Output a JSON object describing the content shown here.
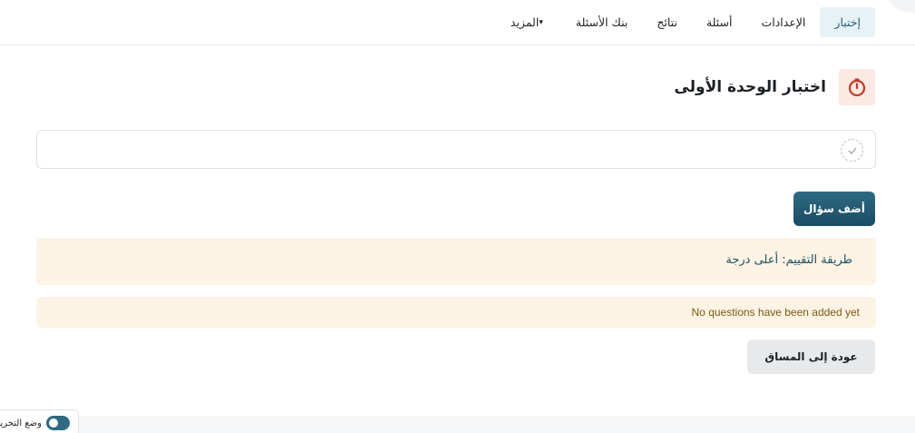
{
  "nav": {
    "tabs": [
      {
        "label": "إختبار",
        "active": true
      },
      {
        "label": "الإعدادات",
        "active": false
      },
      {
        "label": "أسئلة",
        "active": false
      },
      {
        "label": "نتائج",
        "active": false
      },
      {
        "label": "بنك الأسئلة",
        "active": false
      },
      {
        "label": "المزيد",
        "active": false,
        "has_dropdown": true
      }
    ]
  },
  "header": {
    "title": "اختبار الوحدة الأولى",
    "icon": "stopwatch-icon",
    "icon_color": "#c0392b"
  },
  "completion": {
    "icon": "check-circle-icon"
  },
  "actions": {
    "add_question_label": "أضف سؤال",
    "back_label": "عودة إلى المساق"
  },
  "grading": {
    "method_text": "طريقة التقييم: أعلى درجة"
  },
  "notice": {
    "no_questions_text": "No questions have been added yet"
  },
  "footer": {
    "edit_mode_label": "وضع التحرير"
  },
  "colors": {
    "accent": "#1f5f7a",
    "button_primary": "#245a70",
    "notice_bg": "#fdf3e4",
    "active_tab_bg": "#e7f2f6"
  }
}
